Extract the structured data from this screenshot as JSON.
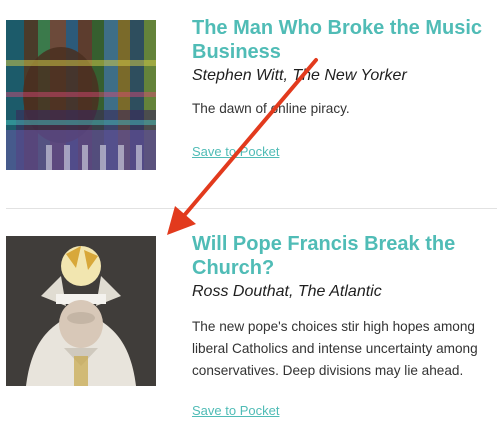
{
  "articles": [
    {
      "title": "The Man Who Broke the Music Business",
      "byline": "Stephen Witt, The New Yorker",
      "excerpt": "The dawn of online piracy.",
      "save_label": "Save to Pocket"
    },
    {
      "title": "Will Pope Francis Break the Church?",
      "byline": "Ross Douthat, The Atlantic",
      "excerpt": "The new pope's choices stir high hopes among liberal Catholics and intense uncertainty among conservatives. Deep divisions may lie ahead.",
      "save_label": "Save to Pocket"
    }
  ],
  "colors": {
    "accent": "#50bcb6",
    "arrow": "#e23a1d",
    "divider": "#e2e2e2"
  }
}
